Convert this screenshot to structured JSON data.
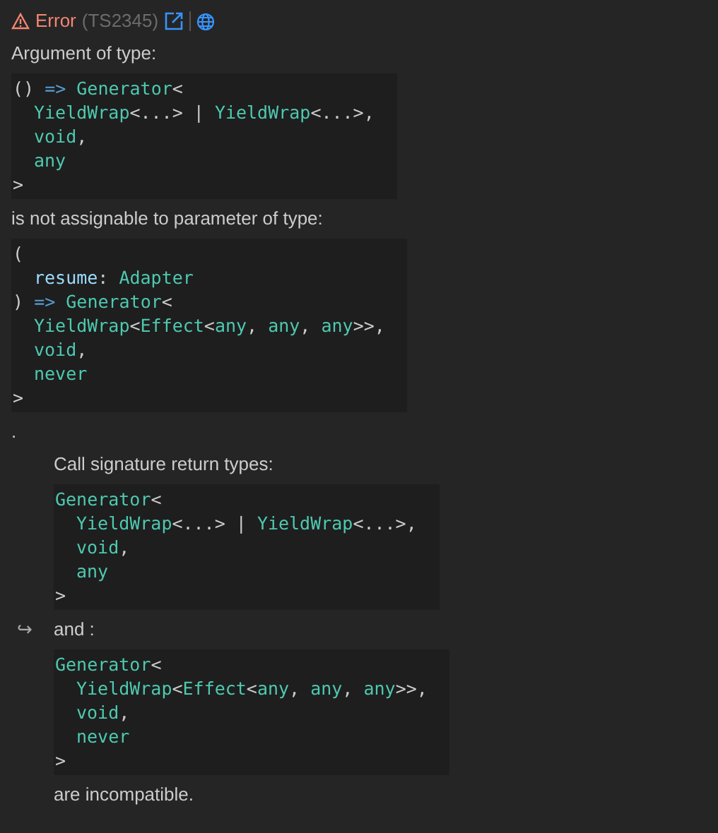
{
  "header": {
    "severity": "Error",
    "code": "(TS2345)"
  },
  "blocks": [
    {
      "kind": "text",
      "text": "Argument of type:",
      "nested": false
    },
    {
      "kind": "code",
      "nested": false,
      "lines": [
        {
          "indented": false,
          "tokens": [
            {
              "kind": "punct",
              "text": "() "
            },
            {
              "kind": "keyword",
              "text": "=> "
            },
            {
              "kind": "type",
              "text": "Generator"
            },
            {
              "kind": "punct",
              "text": "<"
            }
          ]
        },
        {
          "indented": true,
          "tokens": [
            {
              "kind": "type",
              "text": "YieldWrap"
            },
            {
              "kind": "punct",
              "text": "<...> | "
            },
            {
              "kind": "type",
              "text": "YieldWrap"
            },
            {
              "kind": "punct",
              "text": "<...>,"
            }
          ]
        },
        {
          "indented": true,
          "tokens": [
            {
              "kind": "type",
              "text": "void"
            },
            {
              "kind": "punct",
              "text": ","
            }
          ]
        },
        {
          "indented": true,
          "tokens": [
            {
              "kind": "type",
              "text": "any"
            }
          ]
        },
        {
          "indented": false,
          "tokens": [
            {
              "kind": "punct",
              "text": ">"
            }
          ]
        }
      ]
    },
    {
      "kind": "text",
      "text": "is not assignable to parameter of type:",
      "nested": false
    },
    {
      "kind": "code",
      "nested": false,
      "lines": [
        {
          "indented": false,
          "tokens": [
            {
              "kind": "punct",
              "text": "("
            }
          ]
        },
        {
          "indented": true,
          "tokens": [
            {
              "kind": "param",
              "text": "resume"
            },
            {
              "kind": "punct",
              "text": ": "
            },
            {
              "kind": "type",
              "text": "Adapter"
            }
          ]
        },
        {
          "indented": false,
          "tokens": [
            {
              "kind": "punct",
              "text": ") "
            },
            {
              "kind": "keyword",
              "text": "=> "
            },
            {
              "kind": "type",
              "text": "Generator"
            },
            {
              "kind": "punct",
              "text": "<"
            }
          ]
        },
        {
          "indented": true,
          "tokens": [
            {
              "kind": "type",
              "text": "YieldWrap"
            },
            {
              "kind": "punct",
              "text": "<"
            },
            {
              "kind": "type",
              "text": "Effect"
            },
            {
              "kind": "punct",
              "text": "<"
            },
            {
              "kind": "type",
              "text": "any"
            },
            {
              "kind": "punct",
              "text": ", "
            },
            {
              "kind": "type",
              "text": "any"
            },
            {
              "kind": "punct",
              "text": ", "
            },
            {
              "kind": "type",
              "text": "any"
            },
            {
              "kind": "punct",
              "text": ">>,"
            }
          ]
        },
        {
          "indented": true,
          "tokens": [
            {
              "kind": "type",
              "text": "void"
            },
            {
              "kind": "punct",
              "text": ","
            }
          ]
        },
        {
          "indented": true,
          "tokens": [
            {
              "kind": "type",
              "text": "never"
            }
          ]
        },
        {
          "indented": false,
          "tokens": [
            {
              "kind": "punct",
              "text": ">"
            }
          ]
        }
      ]
    },
    {
      "kind": "text",
      "text": ".",
      "nested": false
    },
    {
      "kind": "text",
      "text": "Call signature return types:",
      "nested": true
    },
    {
      "kind": "code",
      "nested": true,
      "lines": [
        {
          "indented": false,
          "tokens": [
            {
              "kind": "type",
              "text": "Generator"
            },
            {
              "kind": "punct",
              "text": "<"
            }
          ]
        },
        {
          "indented": true,
          "tokens": [
            {
              "kind": "type",
              "text": "YieldWrap"
            },
            {
              "kind": "punct",
              "text": "<...> | "
            },
            {
              "kind": "type",
              "text": "YieldWrap"
            },
            {
              "kind": "punct",
              "text": "<...>,"
            }
          ]
        },
        {
          "indented": true,
          "tokens": [
            {
              "kind": "type",
              "text": "void"
            },
            {
              "kind": "punct",
              "text": ","
            }
          ]
        },
        {
          "indented": true,
          "tokens": [
            {
              "kind": "type",
              "text": "any"
            }
          ]
        },
        {
          "indented": false,
          "tokens": [
            {
              "kind": "punct",
              "text": ">"
            }
          ]
        }
      ]
    },
    {
      "kind": "arrow-text",
      "marker": "↪",
      "text": "and :",
      "nested": true
    },
    {
      "kind": "code",
      "nested": true,
      "lines": [
        {
          "indented": false,
          "tokens": [
            {
              "kind": "type",
              "text": "Generator"
            },
            {
              "kind": "punct",
              "text": "<"
            }
          ]
        },
        {
          "indented": true,
          "tokens": [
            {
              "kind": "type",
              "text": "YieldWrap"
            },
            {
              "kind": "punct",
              "text": "<"
            },
            {
              "kind": "type",
              "text": "Effect"
            },
            {
              "kind": "punct",
              "text": "<"
            },
            {
              "kind": "type",
              "text": "any"
            },
            {
              "kind": "punct",
              "text": ", "
            },
            {
              "kind": "type",
              "text": "any"
            },
            {
              "kind": "punct",
              "text": ", "
            },
            {
              "kind": "type",
              "text": "any"
            },
            {
              "kind": "punct",
              "text": ">>,"
            }
          ]
        },
        {
          "indented": true,
          "tokens": [
            {
              "kind": "type",
              "text": "void"
            },
            {
              "kind": "punct",
              "text": ","
            }
          ]
        },
        {
          "indented": true,
          "tokens": [
            {
              "kind": "type",
              "text": "never"
            }
          ]
        },
        {
          "indented": false,
          "tokens": [
            {
              "kind": "punct",
              "text": ">"
            }
          ]
        }
      ]
    },
    {
      "kind": "text",
      "text": "are incompatible.",
      "nested": true
    }
  ]
}
